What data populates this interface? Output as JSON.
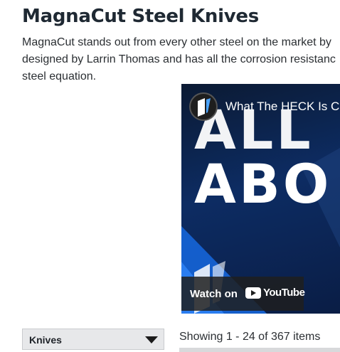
{
  "header": {
    "title": "MagnaCut Steel Knives"
  },
  "intro": {
    "lines": [
      "MagnaCut stands out from every other steel on the market by",
      "designed by Larrin Thomas and has all the corrosion resistanc",
      "steel equation."
    ]
  },
  "video": {
    "title": "What The HECK Is C",
    "big_word_1": "ALL",
    "big_word_2": "ABO",
    "watch_label": "Watch on",
    "platform": "YouTube",
    "icons": [
      "channel-logo-icon",
      "youtube-logo-icon"
    ]
  },
  "listing": {
    "filter_label": "Knives",
    "showing_text": "Showing 1 - 24 of 367 items"
  },
  "colors": {
    "title": "#1f2933",
    "video_bg": "#0d2c63",
    "filter_bg": "#e7e8ea"
  }
}
